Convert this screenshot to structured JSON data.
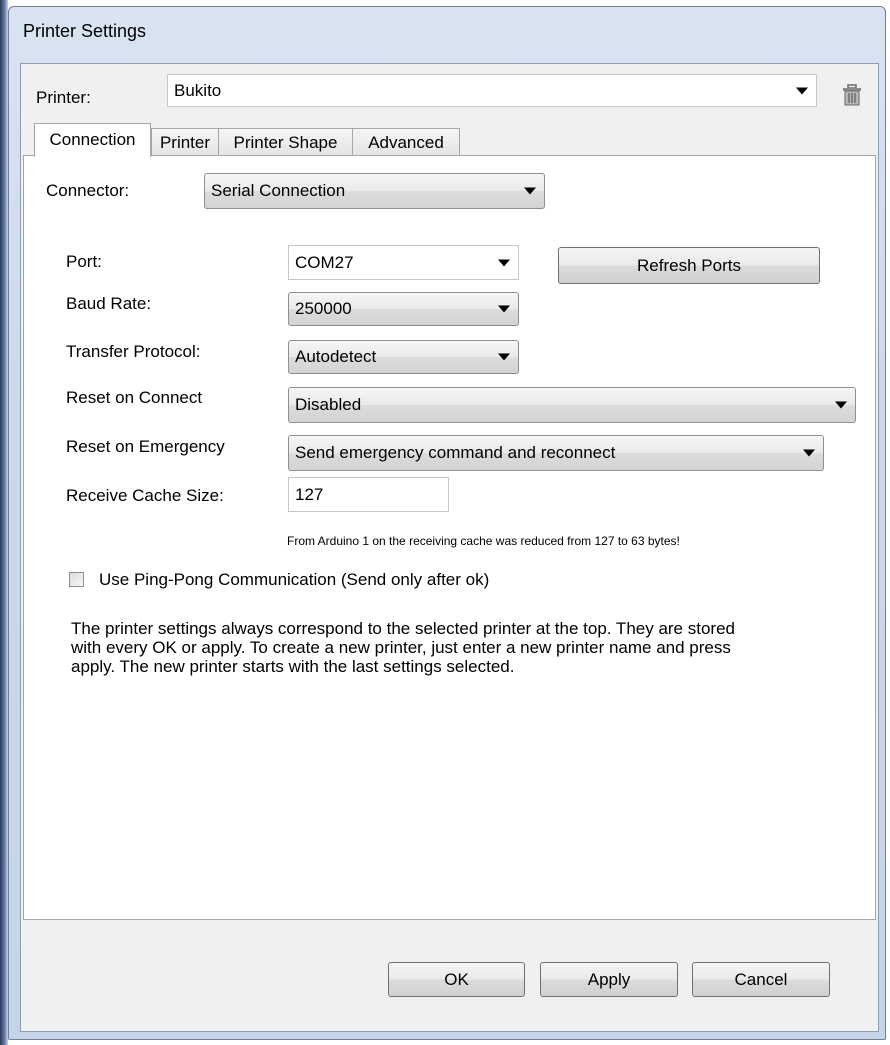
{
  "window": {
    "title": "Printer Settings"
  },
  "printer_bar": {
    "label": "Printer:",
    "selected": "Bukito",
    "delete_icon": "trash-icon"
  },
  "tabs": [
    {
      "label": "Connection",
      "active": true
    },
    {
      "label": "Printer",
      "active": false
    },
    {
      "label": "Printer Shape",
      "active": false
    },
    {
      "label": "Advanced",
      "active": false
    }
  ],
  "connection": {
    "connector_label": "Connector:",
    "connector_value": "Serial Connection",
    "port_label": "Port:",
    "port_value": "COM27",
    "refresh_label": "Refresh Ports",
    "baud_label": "Baud Rate:",
    "baud_value": "250000",
    "protocol_label": "Transfer Protocol:",
    "protocol_value": "Autodetect",
    "reset_connect_label": "Reset on Connect",
    "reset_connect_value": "Disabled",
    "reset_emergency_label": "Reset on Emergency",
    "reset_emergency_value": "Send emergency command and reconnect",
    "cache_label": "Receive Cache Size:",
    "cache_value": "127",
    "cache_note": "From Arduino 1 on the receiving cache was reduced from 127 to 63 bytes!",
    "pingpong_label": "Use Ping-Pong Communication (Send only after ok)",
    "pingpong_checked": false,
    "info_text": "The printer settings always correspond to the selected printer at the top. They are stored with every OK or apply. To create a new printer, just enter a new printer name and press apply. The new printer starts with the last settings selected."
  },
  "buttons": {
    "ok": "OK",
    "apply": "Apply",
    "cancel": "Cancel"
  }
}
